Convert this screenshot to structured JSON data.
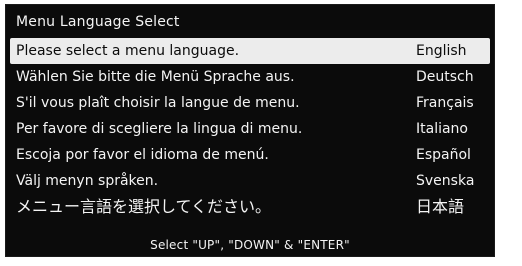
{
  "menu": {
    "title": "Menu Language Select",
    "items": [
      {
        "prompt": "Please select a menu language.",
        "language": "English",
        "selected": true
      },
      {
        "prompt": "Wählen Sie bitte die Menü Sprache aus.",
        "language": "Deutsch",
        "selected": false
      },
      {
        "prompt": "S'il vous plaît choisir la langue de menu.",
        "language": "Français",
        "selected": false
      },
      {
        "prompt": "Per favore di scegliere la lingua di menu.",
        "language": "Italiano",
        "selected": false
      },
      {
        "prompt": "Escoja por favor el idioma de menú.",
        "language": "Español",
        "selected": false
      },
      {
        "prompt": "Välj menyn språken.",
        "language": "Svenska",
        "selected": false
      },
      {
        "prompt": "メニュー言語を選択してください。",
        "language": "日本語",
        "selected": false
      }
    ],
    "footer": "Select \"UP\", \"DOWN\" & \"ENTER\""
  },
  "colors": {
    "panel_bg": "#0b0b0b",
    "text": "#f4f4f4",
    "highlight_bg": "#ececec",
    "highlight_text": "#0b0b0b"
  }
}
